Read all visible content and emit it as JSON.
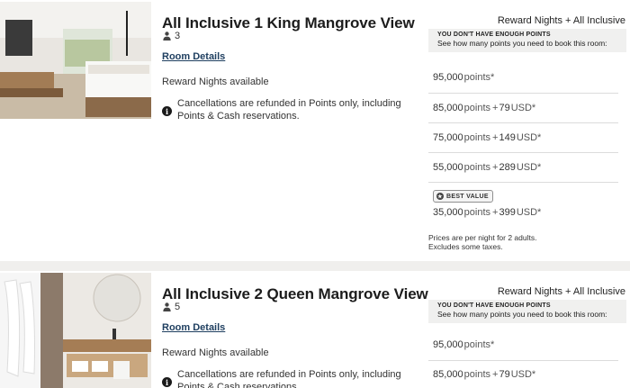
{
  "rooms": [
    {
      "title": "All Inclusive 1 King Mangrove View",
      "guests": "3",
      "room_details_link": "Room Details",
      "availability": "Reward Nights available",
      "cancellation": "Cancellations are refunded in Points only, including Points & Cash reservations.",
      "rate_type": "Reward Nights + All Inclusive",
      "notice_title": "YOU DON'T HAVE ENOUGH POINTS",
      "notice_subtitle": "See how many points you need to book this room:",
      "prices": [
        {
          "points": "95,000",
          "points_label": "points*",
          "plus": "",
          "cash": "",
          "currency": ""
        },
        {
          "points": "85,000",
          "points_label": "points",
          "plus": "+",
          "cash": "79",
          "currency": "USD*"
        },
        {
          "points": "75,000",
          "points_label": "points",
          "plus": "+",
          "cash": "149",
          "currency": "USD*"
        },
        {
          "points": "55,000",
          "points_label": "points",
          "plus": "+",
          "cash": "289",
          "currency": "USD*"
        },
        {
          "points": "35,000",
          "points_label": "points",
          "plus": "+",
          "cash": "399",
          "currency": "USD*"
        }
      ],
      "best_value_label": "BEST VALUE",
      "footnote_line1": "Prices are per night for 2 adults.",
      "footnote_line2": "Excludes some taxes."
    },
    {
      "title": "All Inclusive 2 Queen Mangrove View",
      "guests": "5",
      "room_details_link": "Room Details",
      "availability": "Reward Nights available",
      "cancellation": "Cancellations are refunded in Points only, including Points & Cash reservations.",
      "rate_type": "Reward Nights + All Inclusive",
      "notice_title": "YOU DON'T HAVE ENOUGH POINTS",
      "notice_subtitle": "See how many points you need to book this room:",
      "prices": [
        {
          "points": "95,000",
          "points_label": "points*",
          "plus": "",
          "cash": "",
          "currency": ""
        },
        {
          "points": "85,000",
          "points_label": "points",
          "plus": "+",
          "cash": "79",
          "currency": "USD*"
        }
      ]
    }
  ],
  "icons": {
    "guest": "person-icon",
    "info": "info-icon",
    "best_value": "star-badge-icon"
  },
  "colors": {
    "link": "#1f3f60",
    "notice_bg": "#f0f0ef",
    "page_bg": "#f0efed"
  }
}
